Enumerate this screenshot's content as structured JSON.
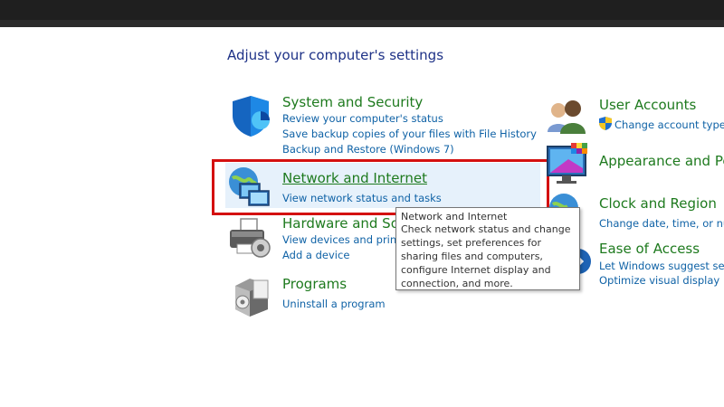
{
  "heading": "Adjust your computer's settings",
  "left_categories": [
    {
      "title": "System and Security",
      "icon": "shield-icon",
      "links": [
        "Review your computer's status",
        "Save backup copies of your files with File History",
        "Backup and Restore (Windows 7)"
      ]
    },
    {
      "title": "Network and Internet",
      "icon": "network-globe-icon",
      "links": [
        "View network status and tasks"
      ]
    },
    {
      "title": "Hardware and Sou",
      "icon": "printer-icon",
      "links": [
        "View devices and printe",
        "Add a device"
      ]
    },
    {
      "title": "Programs",
      "icon": "programs-box-icon",
      "links": [
        "Uninstall a program"
      ]
    }
  ],
  "right_categories": [
    {
      "title": "User Accounts",
      "icon": "users-icon",
      "links": [
        "Change account type"
      ]
    },
    {
      "title": "Appearance and Per",
      "icon": "monitor-palette-icon",
      "links": []
    },
    {
      "title": "Clock and Region",
      "icon": "clock-globe-icon",
      "links": [
        "Change date, time, or num"
      ]
    },
    {
      "title": "Ease of Access",
      "icon": "ease-access-icon",
      "links": [
        "Let Windows suggest setti",
        "Optimize visual display"
      ]
    }
  ],
  "tooltip": {
    "title": "Network and Internet",
    "body": "Check network status and change settings, set preferences for sharing files and computers, configure Internet display and connection, and more."
  },
  "colors": {
    "title_green": "#1e7a1e",
    "link_blue": "#0f62a6",
    "heading_blue": "#1e3287",
    "highlight": "#d41010",
    "hover_bg": "#e6f1fb"
  }
}
